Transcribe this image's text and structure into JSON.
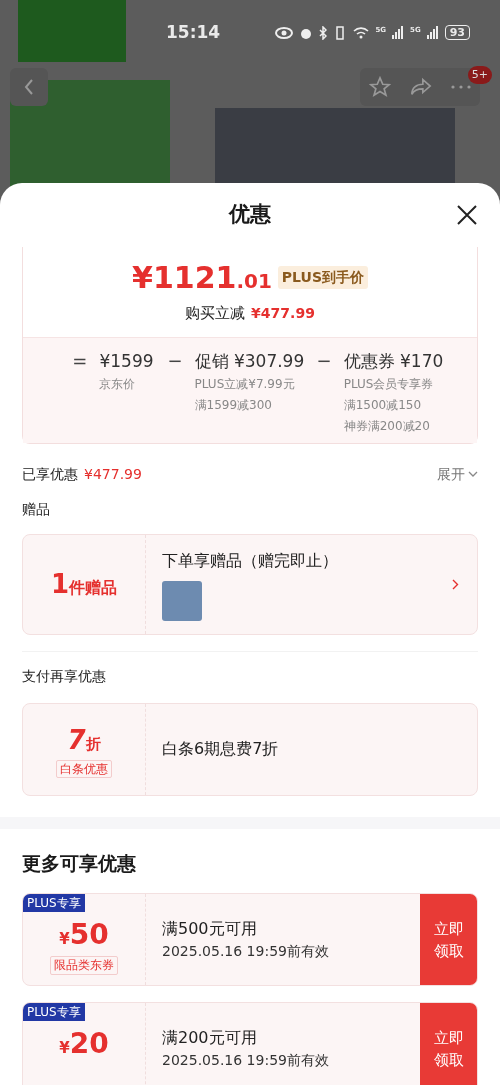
{
  "status_bar": {
    "time": "15:14",
    "network_1": "5G",
    "network_2": "5G",
    "battery": "93"
  },
  "top_bar": {
    "badge": "5+"
  },
  "sheet": {
    "title": "优惠"
  },
  "price": {
    "amount_main": "¥1121",
    "amount_decimal": ".01",
    "tag": "PLUS到手价",
    "reduction_label": "购买立减",
    "reduction_value": "¥477.99"
  },
  "breakdown": [
    {
      "op": "=",
      "value": "¥1599",
      "notes": [
        "京东价"
      ]
    },
    {
      "op": "−",
      "value": "促销 ¥307.99",
      "notes": [
        "PLUS立减¥7.99元",
        "满1599减300"
      ]
    },
    {
      "op": "−",
      "value": "优惠券 ¥170",
      "notes": [
        "PLUS会员专享券",
        "满1500减150",
        "神券满200减20"
      ]
    }
  ],
  "enjoyed": {
    "label": "已享优惠",
    "value": "¥477.99",
    "toggle": "展开"
  },
  "gift": {
    "section": "赠品",
    "count": "1",
    "unit": "件赠品",
    "title": "下单享赠品（赠完即止）"
  },
  "payment": {
    "section": "支付再享优惠",
    "discount": "7",
    "unit": "折",
    "tag": "白条优惠",
    "text": "白条6期息费7折"
  },
  "more": {
    "title": "更多可享优惠",
    "coupons": [
      {
        "badge": "PLUS专享",
        "currency": "¥",
        "amount": "50",
        "tag": "限品类东券",
        "condition": "满500元可用",
        "validity": "2025.05.16 19:59前有效",
        "action": "立即领取"
      },
      {
        "badge": "PLUS专享",
        "currency": "¥",
        "amount": "20",
        "condition": "满200元可用",
        "validity": "2025.05.16 19:59前有效",
        "action": "立即领取"
      }
    ]
  }
}
